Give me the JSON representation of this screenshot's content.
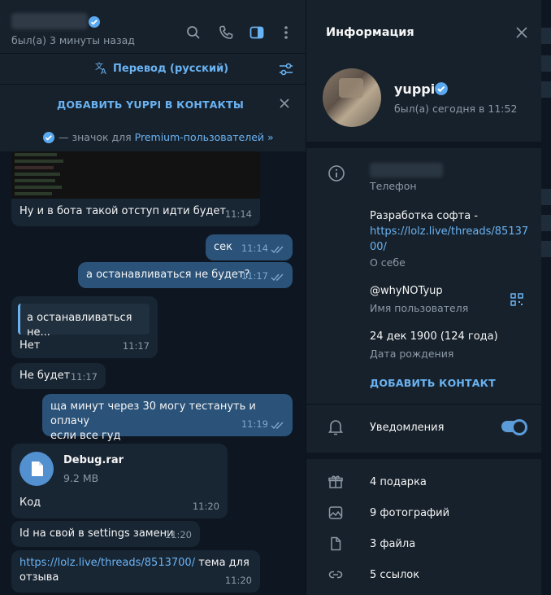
{
  "chat": {
    "header": {
      "status": "был(а) 3 минуты назад",
      "icons": [
        "search-icon",
        "phone-icon",
        "sidebar-toggle-icon",
        "more-vertical-icon"
      ]
    },
    "translate_bar": {
      "label": "Перевод (русский)"
    },
    "add_contact_bar": {
      "label": "ДОБАВИТЬ YUPPI В КОНТАКТЫ",
      "premium_prefix": "— значок для ",
      "premium_link": "Premium-пользователей »"
    },
    "messages": [
      {
        "dir": "in",
        "text": "Ну и в бота такой отступ идти будет",
        "time": "11:14"
      },
      {
        "dir": "out",
        "text": "сек",
        "time": "11:14"
      },
      {
        "dir": "out",
        "text": "а останавливаться не будет?",
        "time": "11:17"
      },
      {
        "dir": "in",
        "reply": "а останавливаться не...",
        "text": "Нет",
        "time": "11:17"
      },
      {
        "dir": "in",
        "text": "Не будет",
        "time": "11:17"
      },
      {
        "dir": "out",
        "text_line1": "ща минут через 30 могу тестануть и оплачу",
        "text_line2": "если все гуд",
        "time": "11:19"
      },
      {
        "dir": "in",
        "file_name": "Debug.rar",
        "file_size": "9.2 MB",
        "text": "Код",
        "time": "11:20"
      },
      {
        "dir": "in",
        "text": "Id на свой в settings замени",
        "time": "11:20"
      },
      {
        "dir": "in",
        "link": "https://lolz.live/threads/8513700/",
        "text_after": " тема для",
        "text_line2": "отзыва",
        "time": "11:20"
      }
    ]
  },
  "panel": {
    "title": "Информация",
    "profile": {
      "name": "yuppi",
      "status": "был(а) сегодня в 11:52"
    },
    "phone_label": "Телефон",
    "about": {
      "line1": "Разработка софта -",
      "link1": "https://lolz.live/threads/85137",
      "link2": "00/",
      "label": "О себе"
    },
    "username": {
      "value": "@whyNOTyup",
      "label": "Имя пользователя"
    },
    "birthday": {
      "value": "24 дек 1900 (124 года)",
      "label": "Дата рождения"
    },
    "add_contact": "ДОБАВИТЬ КОНТАКТ",
    "notifications": {
      "label": "Уведомления",
      "enabled": true
    },
    "media": [
      {
        "icon": "gift-icon",
        "label": "4 подарка"
      },
      {
        "icon": "photo-icon",
        "label": "9 фотографий"
      },
      {
        "icon": "file-icon",
        "label": "3 файла"
      },
      {
        "icon": "link-icon",
        "label": "5 ссылок"
      }
    ]
  },
  "colors": {
    "accent": "#6ab3f3",
    "bubble_out": "#2b5278",
    "bubble_in": "#182533",
    "bg": "#0e1621",
    "panel": "#17212b"
  }
}
